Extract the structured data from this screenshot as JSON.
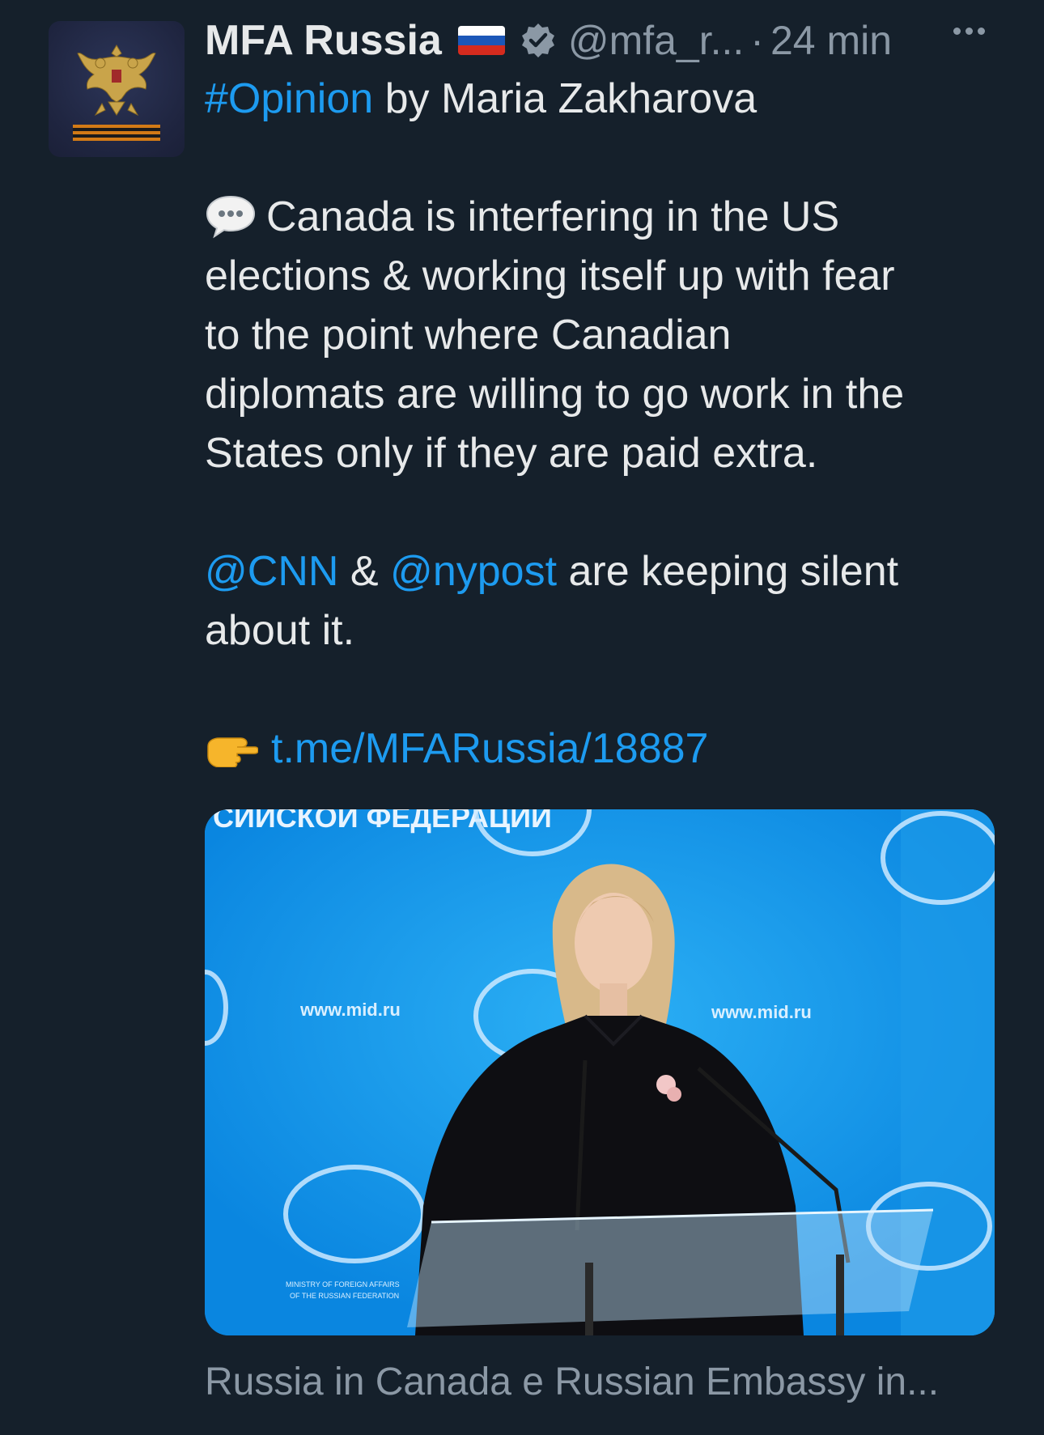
{
  "tweet": {
    "author": {
      "display_name": "MFA Russia",
      "handle": "@mfa_r...",
      "flag_icon": "russia-flag-icon",
      "verified_icon": "verified-badge-icon"
    },
    "separator": "·",
    "timestamp": "24 min",
    "body": {
      "hashtag": "#Opinion",
      "intro_rest": " by Maria Zakharova",
      "para1_lines": [
        "Canada is interfering in the US",
        "elections & working itself up with fear",
        "to the point where Canadian",
        "diplomats are willing to go work in the",
        "States only if they are paid extra."
      ],
      "mention1": "@CNN",
      "amp": " & ",
      "mention2": "@nypost",
      "para2_rest": " are keeping silent",
      "para2_line2": "about it.",
      "link_text": "t.me/MFARussia/18887"
    },
    "media": {
      "banner_text": "СИЙСКОЙ ФЕДЕРАЦИИ",
      "website_text": "www.mid.ru",
      "website_text_right": "www.mid.ru",
      "ministry_text_1": "MINISTRY OF FOREIGN AFFAIRS",
      "ministry_text_2": "OF THE RUSSIAN FEDERATION"
    },
    "card_caption": "Russia in Canada e Russian Embassy in..."
  },
  "colors": {
    "background": "#15202b",
    "text": "#e7e9ea",
    "muted": "#8b98a5",
    "link": "#1d9bf0"
  }
}
